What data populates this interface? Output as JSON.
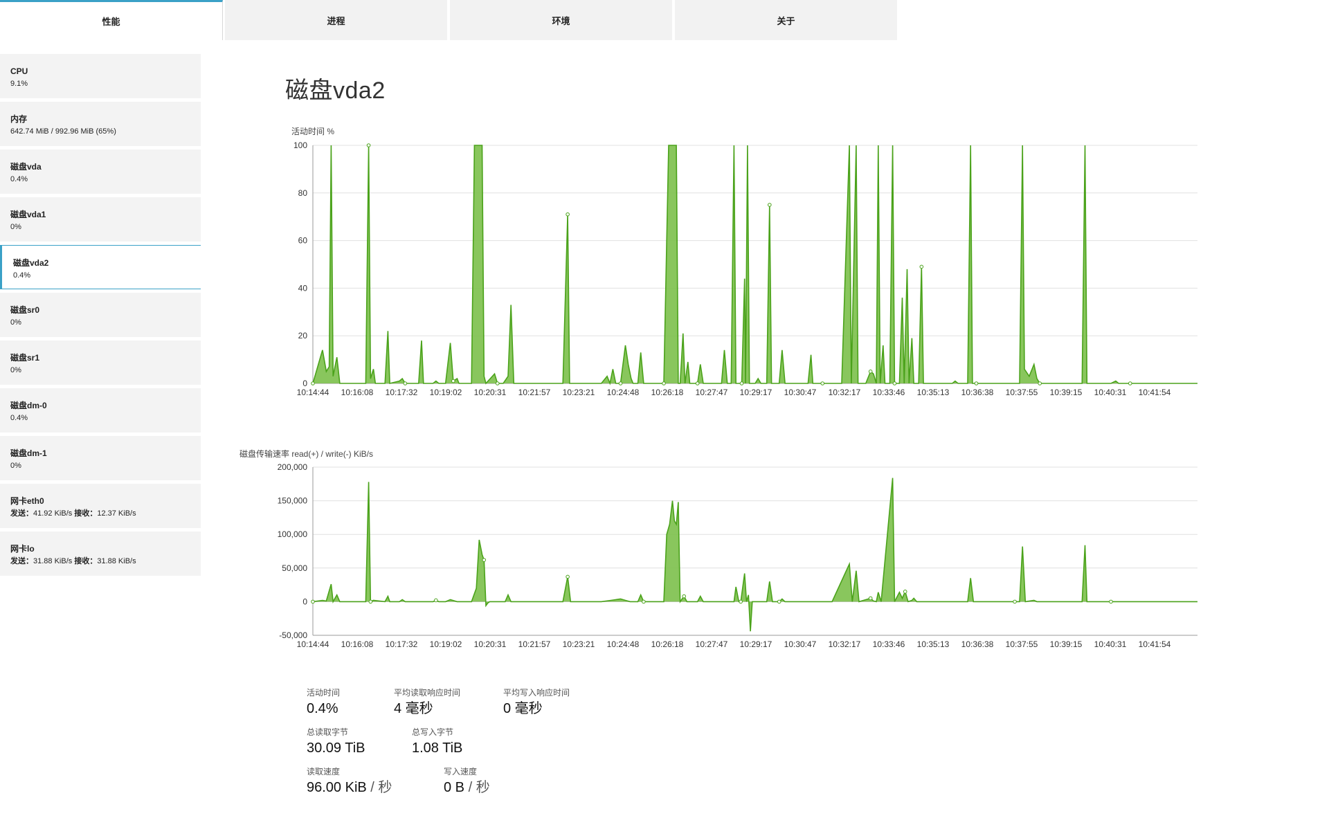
{
  "tabs": [
    {
      "label": "性能",
      "active": true
    },
    {
      "label": "进程",
      "active": false
    },
    {
      "label": "环境",
      "active": false
    },
    {
      "label": "关于",
      "active": false
    }
  ],
  "sidebar": [
    {
      "name": "CPU",
      "value": "9.1%"
    },
    {
      "name": "内存",
      "value": "642.74 MiB / 992.96 MiB (65%)"
    },
    {
      "name": "磁盘vda",
      "value": "0.4%"
    },
    {
      "name": "磁盘vda1",
      "value": "0%"
    },
    {
      "name": "磁盘vda2",
      "value": "0.4%",
      "active": true
    },
    {
      "name": "磁盘sr0",
      "value": "0%"
    },
    {
      "name": "磁盘sr1",
      "value": "0%"
    },
    {
      "name": "磁盘dm-0",
      "value": "0.4%"
    },
    {
      "name": "磁盘dm-1",
      "value": "0%"
    },
    {
      "name": "网卡eth0",
      "send_label": "发送：",
      "send": "41.92 KiB/s",
      "recv_label": "接收：",
      "recv": "12.37 KiB/s"
    },
    {
      "name": "网卡lo",
      "send_label": "发送：",
      "send": "31.88 KiB/s",
      "recv_label": "接收：",
      "recv": "31.88 KiB/s"
    }
  ],
  "page_title": "磁盘vda2",
  "stats": {
    "active_time": {
      "label": "活动时间",
      "value": "0.4%"
    },
    "avg_read": {
      "label": "平均读取响应时间",
      "value": "4 毫秒"
    },
    "avg_write": {
      "label": "平均写入响应时间",
      "value": "0 毫秒"
    },
    "total_read": {
      "label": "总读取字节",
      "value": "30.09 TiB"
    },
    "total_write": {
      "label": "总写入字节",
      "value": "1.08 TiB"
    },
    "read_speed": {
      "label": "读取速度",
      "value": "96.00 KiB",
      "sep": " / ",
      "unit": "秒"
    },
    "write_speed": {
      "label": "写入速度",
      "value": "0 B",
      "sep": " / ",
      "unit": "秒"
    }
  },
  "colors": {
    "accent": "#3aa1c7",
    "series_fill": "#7cc04b",
    "series_line": "#4aa21a",
    "grid": "#e0e0e0"
  },
  "chart_data": [
    {
      "type": "area",
      "title": "",
      "ylabel": "活动时间 %",
      "ylim": [
        0,
        100
      ],
      "yticks": [
        0,
        20,
        40,
        60,
        80,
        100
      ],
      "xlim_sec": [
        0,
        1840
      ],
      "xticks": [
        "10:14:44",
        "10:16:08",
        "10:17:32",
        "10:19:02",
        "10:20:31",
        "10:21:57",
        "10:23:21",
        "10:24:48",
        "10:26:18",
        "10:27:47",
        "10:29:17",
        "10:30:47",
        "10:32:17",
        "10:33:46",
        "10:35:13",
        "10:36:38",
        "10:37:55",
        "10:39:15",
        "10:40:31",
        "10:41:54"
      ],
      "grid": true,
      "points": [
        [
          0,
          0
        ],
        [
          20,
          14
        ],
        [
          28,
          5
        ],
        [
          34,
          7
        ],
        [
          38,
          100
        ],
        [
          42,
          3
        ],
        [
          50,
          11
        ],
        [
          56,
          0
        ],
        [
          110,
          0
        ],
        [
          116,
          100
        ],
        [
          120,
          2
        ],
        [
          126,
          6
        ],
        [
          130,
          0
        ],
        [
          150,
          0
        ],
        [
          156,
          22
        ],
        [
          160,
          0
        ],
        [
          180,
          1
        ],
        [
          186,
          2
        ],
        [
          192,
          0
        ],
        [
          220,
          0
        ],
        [
          226,
          18
        ],
        [
          230,
          0
        ],
        [
          250,
          0
        ],
        [
          256,
          1
        ],
        [
          262,
          0
        ],
        [
          276,
          0
        ],
        [
          286,
          17
        ],
        [
          292,
          1
        ],
        [
          300,
          2
        ],
        [
          304,
          0
        ],
        [
          330,
          0
        ],
        [
          336,
          100
        ],
        [
          352,
          100
        ],
        [
          356,
          3
        ],
        [
          360,
          0
        ],
        [
          378,
          4
        ],
        [
          384,
          0
        ],
        [
          396,
          0
        ],
        [
          406,
          3
        ],
        [
          412,
          33
        ],
        [
          418,
          0
        ],
        [
          440,
          0
        ],
        [
          464,
          0
        ],
        [
          500,
          0
        ],
        [
          520,
          0
        ],
        [
          530,
          71
        ],
        [
          534,
          0
        ],
        [
          560,
          0
        ],
        [
          580,
          0
        ],
        [
          600,
          0
        ],
        [
          612,
          3
        ],
        [
          618,
          0
        ],
        [
          624,
          6
        ],
        [
          630,
          0
        ],
        [
          640,
          0
        ],
        [
          650,
          16
        ],
        [
          656,
          8
        ],
        [
          662,
          2
        ],
        [
          666,
          0
        ],
        [
          676,
          0
        ],
        [
          682,
          13
        ],
        [
          688,
          0
        ],
        [
          720,
          0
        ],
        [
          730,
          0
        ],
        [
          740,
          100
        ],
        [
          756,
          100
        ],
        [
          760,
          0
        ],
        [
          764,
          0
        ],
        [
          770,
          21
        ],
        [
          774,
          0
        ],
        [
          780,
          9
        ],
        [
          784,
          0
        ],
        [
          800,
          0
        ],
        [
          806,
          8
        ],
        [
          812,
          0
        ],
        [
          850,
          0
        ],
        [
          856,
          14
        ],
        [
          862,
          0
        ],
        [
          870,
          0
        ],
        [
          876,
          100
        ],
        [
          880,
          0
        ],
        [
          892,
          0
        ],
        [
          898,
          44
        ],
        [
          900,
          0
        ],
        [
          904,
          100
        ],
        [
          908,
          0
        ],
        [
          920,
          0
        ],
        [
          926,
          2
        ],
        [
          932,
          0
        ],
        [
          944,
          0
        ],
        [
          950,
          75
        ],
        [
          954,
          0
        ],
        [
          970,
          0
        ],
        [
          976,
          14
        ],
        [
          982,
          0
        ],
        [
          1000,
          0
        ],
        [
          1030,
          0
        ],
        [
          1036,
          12
        ],
        [
          1040,
          0
        ],
        [
          1060,
          0
        ],
        [
          1080,
          0
        ],
        [
          1100,
          0
        ],
        [
          1116,
          100
        ],
        [
          1120,
          0
        ],
        [
          1130,
          100
        ],
        [
          1134,
          0
        ],
        [
          1140,
          0
        ],
        [
          1150,
          0
        ],
        [
          1160,
          5
        ],
        [
          1166,
          4
        ],
        [
          1172,
          0
        ],
        [
          1176,
          100
        ],
        [
          1180,
          0
        ],
        [
          1186,
          16
        ],
        [
          1190,
          0
        ],
        [
          1200,
          0
        ],
        [
          1206,
          100
        ],
        [
          1210,
          0
        ],
        [
          1220,
          0
        ],
        [
          1226,
          36
        ],
        [
          1230,
          0
        ],
        [
          1236,
          48
        ],
        [
          1240,
          0
        ],
        [
          1246,
          19
        ],
        [
          1250,
          0
        ],
        [
          1260,
          0
        ],
        [
          1266,
          49
        ],
        [
          1270,
          0
        ],
        [
          1300,
          0
        ],
        [
          1330,
          0
        ],
        [
          1336,
          1
        ],
        [
          1342,
          0
        ],
        [
          1362,
          0
        ],
        [
          1368,
          100
        ],
        [
          1372,
          0
        ],
        [
          1380,
          0
        ],
        [
          1400,
          0
        ],
        [
          1440,
          0
        ],
        [
          1470,
          0
        ],
        [
          1476,
          100
        ],
        [
          1480,
          6
        ],
        [
          1490,
          3
        ],
        [
          1500,
          8
        ],
        [
          1506,
          2
        ],
        [
          1512,
          0
        ],
        [
          1540,
          0
        ],
        [
          1580,
          0
        ],
        [
          1600,
          0
        ],
        [
          1606,
          100
        ],
        [
          1610,
          0
        ],
        [
          1660,
          0
        ],
        [
          1670,
          1
        ],
        [
          1676,
          0
        ],
        [
          1700,
          0
        ],
        [
          1730,
          0
        ],
        [
          1800,
          0
        ],
        [
          1818,
          0
        ],
        [
          1840,
          0
        ]
      ]
    },
    {
      "type": "area",
      "title": "",
      "ylabel": "磁盘传输速率  read(+) / write(-) KiB/s",
      "ylim": [
        -50000,
        200000
      ],
      "yticks": [
        -50000,
        0,
        50000,
        100000,
        150000,
        200000
      ],
      "xlim_sec": [
        0,
        1840
      ],
      "xticks": [
        "10:14:44",
        "10:16:08",
        "10:17:32",
        "10:19:02",
        "10:20:31",
        "10:21:57",
        "10:23:21",
        "10:24:48",
        "10:26:18",
        "10:27:47",
        "10:29:17",
        "10:30:47",
        "10:32:17",
        "10:33:46",
        "10:35:13",
        "10:36:38",
        "10:37:55",
        "10:39:15",
        "10:40:31",
        "10:41:54"
      ],
      "grid": true,
      "points": [
        [
          0,
          0
        ],
        [
          20,
          2000
        ],
        [
          28,
          1000
        ],
        [
          38,
          26000
        ],
        [
          42,
          0
        ],
        [
          50,
          10000
        ],
        [
          56,
          0
        ],
        [
          110,
          0
        ],
        [
          116,
          178000
        ],
        [
          120,
          0
        ],
        [
          126,
          2000
        ],
        [
          150,
          0
        ],
        [
          156,
          8000
        ],
        [
          160,
          0
        ],
        [
          180,
          0
        ],
        [
          186,
          3000
        ],
        [
          192,
          0
        ],
        [
          250,
          0
        ],
        [
          256,
          2000
        ],
        [
          262,
          0
        ],
        [
          276,
          0
        ],
        [
          286,
          3000
        ],
        [
          300,
          0
        ],
        [
          330,
          0
        ],
        [
          340,
          20000
        ],
        [
          346,
          92000
        ],
        [
          352,
          70000
        ],
        [
          356,
          62000
        ],
        [
          360,
          -6000
        ],
        [
          364,
          -2000
        ],
        [
          368,
          0
        ],
        [
          400,
          0
        ],
        [
          406,
          10000
        ],
        [
          412,
          0
        ],
        [
          464,
          0
        ],
        [
          520,
          0
        ],
        [
          530,
          37000
        ],
        [
          536,
          0
        ],
        [
          600,
          0
        ],
        [
          620,
          2000
        ],
        [
          640,
          4000
        ],
        [
          650,
          2000
        ],
        [
          660,
          0
        ],
        [
          676,
          0
        ],
        [
          682,
          10000
        ],
        [
          688,
          0
        ],
        [
          730,
          0
        ],
        [
          736,
          100000
        ],
        [
          742,
          115000
        ],
        [
          748,
          150000
        ],
        [
          752,
          120000
        ],
        [
          756,
          115000
        ],
        [
          760,
          148000
        ],
        [
          764,
          0
        ],
        [
          772,
          8000
        ],
        [
          778,
          0
        ],
        [
          800,
          0
        ],
        [
          806,
          8000
        ],
        [
          812,
          0
        ],
        [
          850,
          0
        ],
        [
          876,
          0
        ],
        [
          880,
          22000
        ],
        [
          886,
          0
        ],
        [
          890,
          0
        ],
        [
          898,
          42000
        ],
        [
          902,
          0
        ],
        [
          906,
          10000
        ],
        [
          910,
          -44000
        ],
        [
          914,
          0
        ],
        [
          944,
          0
        ],
        [
          950,
          30000
        ],
        [
          956,
          0
        ],
        [
          970,
          0
        ],
        [
          976,
          4000
        ],
        [
          982,
          0
        ],
        [
          1030,
          0
        ],
        [
          1080,
          0
        ],
        [
          1116,
          56000
        ],
        [
          1122,
          0
        ],
        [
          1130,
          46000
        ],
        [
          1136,
          0
        ],
        [
          1160,
          5000
        ],
        [
          1166,
          1000
        ],
        [
          1172,
          0
        ],
        [
          1176,
          14000
        ],
        [
          1182,
          0
        ],
        [
          1206,
          184000
        ],
        [
          1210,
          0
        ],
        [
          1220,
          14000
        ],
        [
          1226,
          5000
        ],
        [
          1232,
          15000
        ],
        [
          1238,
          0
        ],
        [
          1246,
          2000
        ],
        [
          1250,
          5000
        ],
        [
          1256,
          0
        ],
        [
          1330,
          0
        ],
        [
          1362,
          0
        ],
        [
          1368,
          35000
        ],
        [
          1374,
          0
        ],
        [
          1460,
          0
        ],
        [
          1470,
          0
        ],
        [
          1476,
          82000
        ],
        [
          1482,
          0
        ],
        [
          1500,
          2000
        ],
        [
          1506,
          0
        ],
        [
          1600,
          0
        ],
        [
          1606,
          84000
        ],
        [
          1610,
          0
        ],
        [
          1660,
          0
        ],
        [
          1700,
          0
        ],
        [
          1840,
          0
        ]
      ]
    }
  ]
}
